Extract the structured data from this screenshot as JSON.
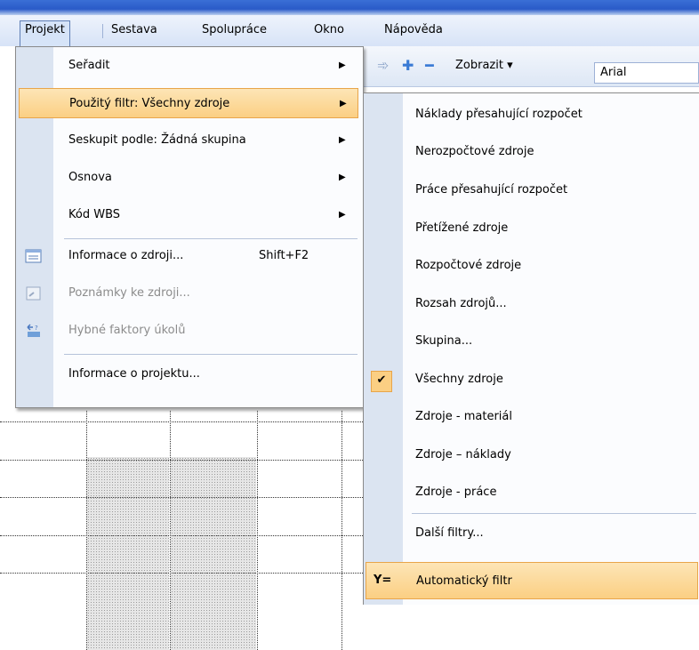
{
  "menubar": {
    "items": [
      {
        "label": "Projekt"
      },
      {
        "label": "Sestava"
      },
      {
        "label": "Spolupráce"
      },
      {
        "label": "Okno"
      },
      {
        "label": "Nápověda"
      }
    ]
  },
  "toolbar": {
    "zobrazit": "Zobrazit ▾",
    "font": "Arial",
    "icons": [
      "arrow-right-icon",
      "plus-icon",
      "minus-icon"
    ]
  },
  "main_menu": {
    "items": [
      {
        "label": "Seřadit",
        "submenu": true
      },
      {
        "label": "Použitý filtr: Všechny zdroje",
        "submenu": true,
        "highlighted": true
      },
      {
        "label": "Seskupit podle: Žádná skupina",
        "submenu": true
      },
      {
        "label": "Osnova",
        "submenu": true
      },
      {
        "label": "Kód WBS",
        "submenu": true
      },
      {
        "label": "Informace o zdroji...",
        "shortcut": "Shift+F2",
        "icon": "resource-info-icon"
      },
      {
        "label": "Poznámky ke zdroji...",
        "disabled": true,
        "icon": "notes-icon"
      },
      {
        "label": "Hybné faktory úkolů",
        "disabled": true,
        "icon": "task-drivers-icon"
      },
      {
        "label": "Informace o projektu..."
      }
    ],
    "arrow_glyph": "▶"
  },
  "sub_menu": {
    "items": [
      {
        "label": "Náklady přesahující rozpočet"
      },
      {
        "label": "Nerozpočtové zdroje"
      },
      {
        "label": "Práce přesahující rozpočet"
      },
      {
        "label": "Přetížené zdroje"
      },
      {
        "label": "Rozpočtové zdroje"
      },
      {
        "label": "Rozsah zdrojů..."
      },
      {
        "label": "Skupina..."
      },
      {
        "label": "Všechny zdroje",
        "checked": true
      },
      {
        "label": "Zdroje - materiál"
      },
      {
        "label": "Zdroje – náklady"
      },
      {
        "label": "Zdroje - práce"
      },
      {
        "label": "Další filtry..."
      },
      {
        "label": "Automatický filtr",
        "highlighted": true,
        "icon": "autofilter-icon"
      }
    ],
    "check_glyph": "✔",
    "autofilter_glyph": "Y="
  },
  "colors": {
    "highlight": "#fbcf83",
    "highlight_border": "#e8a54a",
    "gutter": "#dbe4f1",
    "menubar": "#d7e3f7"
  }
}
